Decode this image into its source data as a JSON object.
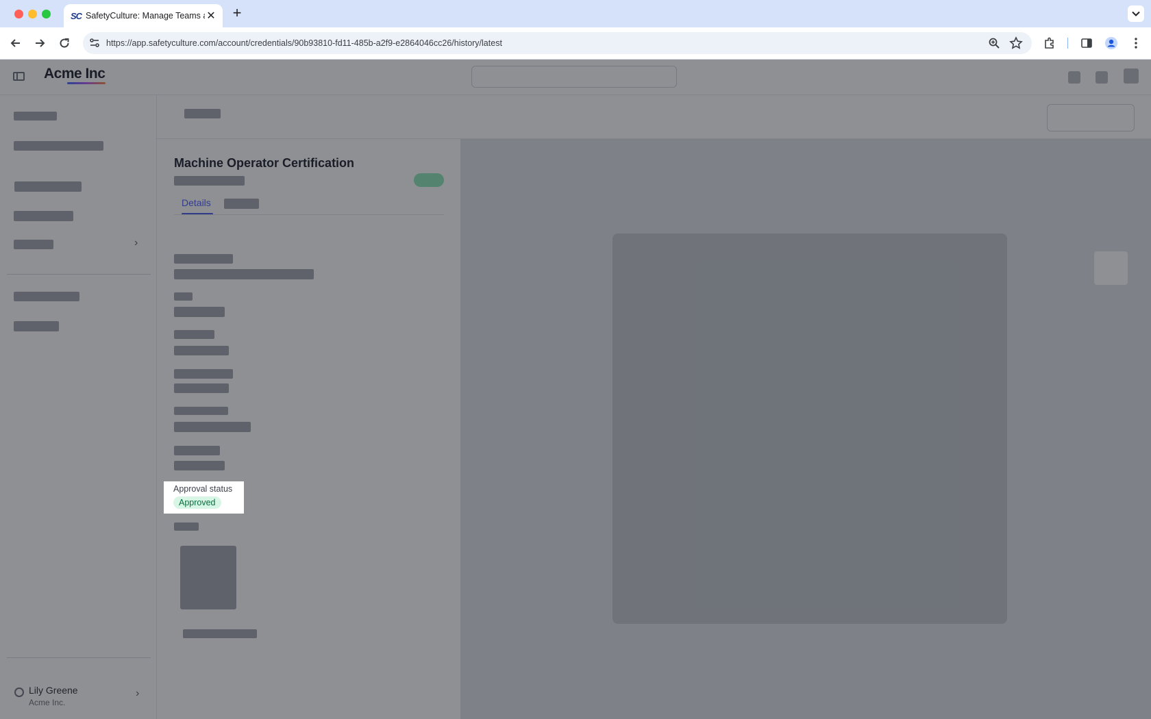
{
  "browser": {
    "tab_title": "SafetyCulture: Manage Teams and...",
    "tab_favicon": "SC",
    "url": "https://app.safetyculture.com/account/credentials/90b93810-fd11-485b-a2f9-e2864046cc26/history/latest",
    "icons": [
      "back-icon",
      "forward-icon",
      "reload-icon",
      "site-settings-icon",
      "zoom-icon",
      "bookmark-star-icon",
      "extensions-icon",
      "side-panel-icon",
      "profile-icon",
      "menu-icon",
      "tab-list-icon",
      "new-tab-icon",
      "close-icon"
    ]
  },
  "app": {
    "brand": "Acme Inc",
    "user_name": "Lily Greene",
    "user_org": "Acme Inc."
  },
  "credential": {
    "title": "Machine Operator Certification",
    "tab_details": "Details",
    "approval_label": "Approval status",
    "approval_value": "Approved"
  },
  "colors": {
    "accent": "#4d5df0",
    "approved_bg": "#d7f6e6",
    "approved_text": "#0e6b3f",
    "overlay": "rgba(20,23,30,0.48)"
  }
}
